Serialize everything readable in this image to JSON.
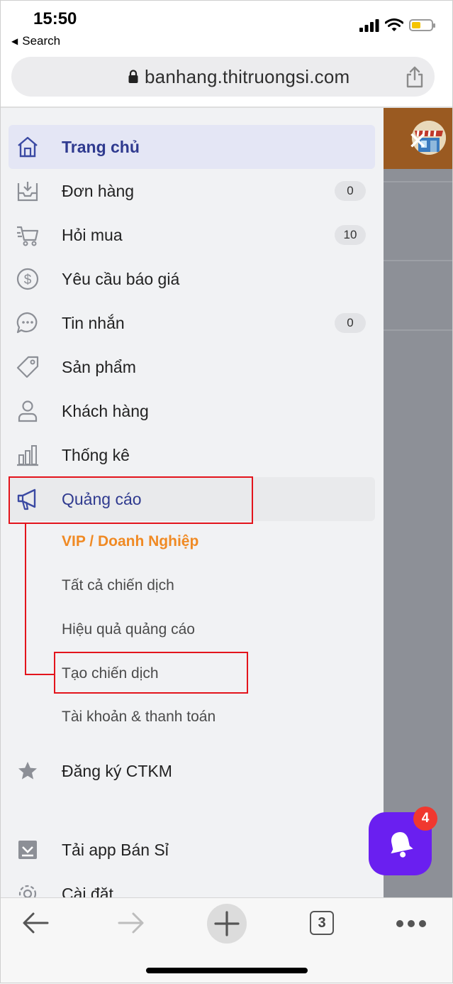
{
  "status": {
    "time": "15:50",
    "back_label": "Search"
  },
  "browser": {
    "url": "banhang.thitruongsi.com",
    "tabs_count": "3"
  },
  "menu": {
    "items": [
      {
        "label": "Trang chủ",
        "icon": "home-icon",
        "badge": ""
      },
      {
        "label": "Đơn hàng",
        "icon": "inbox-download-icon",
        "badge": "0"
      },
      {
        "label": "Hỏi mua",
        "icon": "cart-icon",
        "badge": "10"
      },
      {
        "label": "Yêu cầu báo giá",
        "icon": "dollar-circle-icon",
        "badge": ""
      },
      {
        "label": "Tin nhắn",
        "icon": "chat-bubble-icon",
        "badge": "0"
      },
      {
        "label": "Sản phẩm",
        "icon": "tag-icon",
        "badge": ""
      },
      {
        "label": "Khách hàng",
        "icon": "user-icon",
        "badge": ""
      },
      {
        "label": "Thống kê",
        "icon": "bar-chart-icon",
        "badge": ""
      },
      {
        "label": "Quảng cáo",
        "icon": "megaphone-icon",
        "badge": ""
      }
    ],
    "ads_submenu": [
      "VIP / Doanh Nghiệp",
      "Tất cả chiến dịch",
      "Hiệu quả quảng cáo",
      "Tạo chiến dịch",
      "Tài khoản & thanh toán"
    ],
    "register_promo": "Đăng ký CTKM",
    "download_app": "Tải app Bán Sỉ",
    "settings": "Cài đặt"
  },
  "notification": {
    "count": "4"
  },
  "colors": {
    "accent": "#2f3a8f",
    "orange": "#f08a24",
    "highlight": "#e3141c",
    "bell": "#6a1ff0"
  }
}
